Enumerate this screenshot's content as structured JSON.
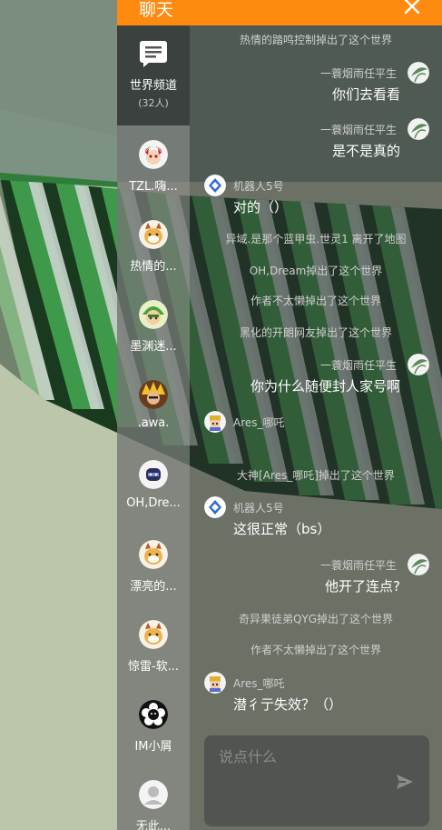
{
  "header": {
    "title": "聊天"
  },
  "sidebar": {
    "world_channel": {
      "name": "世界频道",
      "count": "(32人)"
    },
    "contacts": [
      {
        "name": "TZL.嗨...",
        "avatar": "anime-avatar-icon"
      },
      {
        "name": "热情的...",
        "avatar": "cat-avatar-icon"
      },
      {
        "name": "墨渊迷...",
        "avatar": "green-hero-avatar-icon"
      },
      {
        "name": ".awa.",
        "avatar": "spiky-hair-avatar-icon"
      },
      {
        "name": "OH,Dre...",
        "avatar": "helmet-avatar-icon"
      },
      {
        "name": "漂亮的...",
        "avatar": "cat-avatar-icon"
      },
      {
        "name": "惊雷-软...",
        "avatar": "cat-avatar-icon"
      },
      {
        "name": "IM小屑",
        "avatar": "flower-avatar-icon"
      },
      {
        "name": "无此...",
        "avatar": "default-avatar-icon"
      }
    ]
  },
  "messages": [
    {
      "kind": "sys",
      "text": "热情的踏鸣控制掉出了这个世界"
    },
    {
      "kind": "right",
      "name": "一蓑烟雨任平生",
      "text": "你们去看看"
    },
    {
      "kind": "right",
      "name": "一蓑烟雨任平生",
      "text": "是不是真的"
    },
    {
      "kind": "left",
      "name": "机器人5号",
      "text": "对的（）"
    },
    {
      "kind": "sys",
      "text": "异域.是那个蓝甲虫.世灵1 离开了地图"
    },
    {
      "kind": "sys",
      "text": "OH,Dream掉出了这个世界"
    },
    {
      "kind": "sys",
      "text": "作者不太懒掉出了这个世界"
    },
    {
      "kind": "sys",
      "text": "黑化的开朗网友掉出了这个世界"
    },
    {
      "kind": "right",
      "name": "一蓑烟雨任平生",
      "text": "你为什么随便封人家号啊"
    },
    {
      "kind": "left",
      "name": "Ares_哪吒",
      "text": ""
    },
    {
      "kind": "sys",
      "text": "大神[Ares_哪吒]掉出了这个世界"
    },
    {
      "kind": "left",
      "name": "机器人5号",
      "text": "这很正常（bs）"
    },
    {
      "kind": "right",
      "name": "一蓑烟雨任平生",
      "text": "他开了连点?"
    },
    {
      "kind": "sys",
      "text": "奇异果徒弟QYG掉出了这个世界"
    },
    {
      "kind": "sys",
      "text": "作者不太懒掉出了这个世界"
    },
    {
      "kind": "left",
      "name": "Ares_哪吒",
      "text": "潜彳亍失效？（）"
    }
  ],
  "input": {
    "placeholder": "说点什么"
  },
  "icons": {
    "close": "close-icon",
    "send": "send-icon",
    "world_channel": "chat-bubble-icon"
  },
  "colors": {
    "accent": "#ff8a10"
  }
}
